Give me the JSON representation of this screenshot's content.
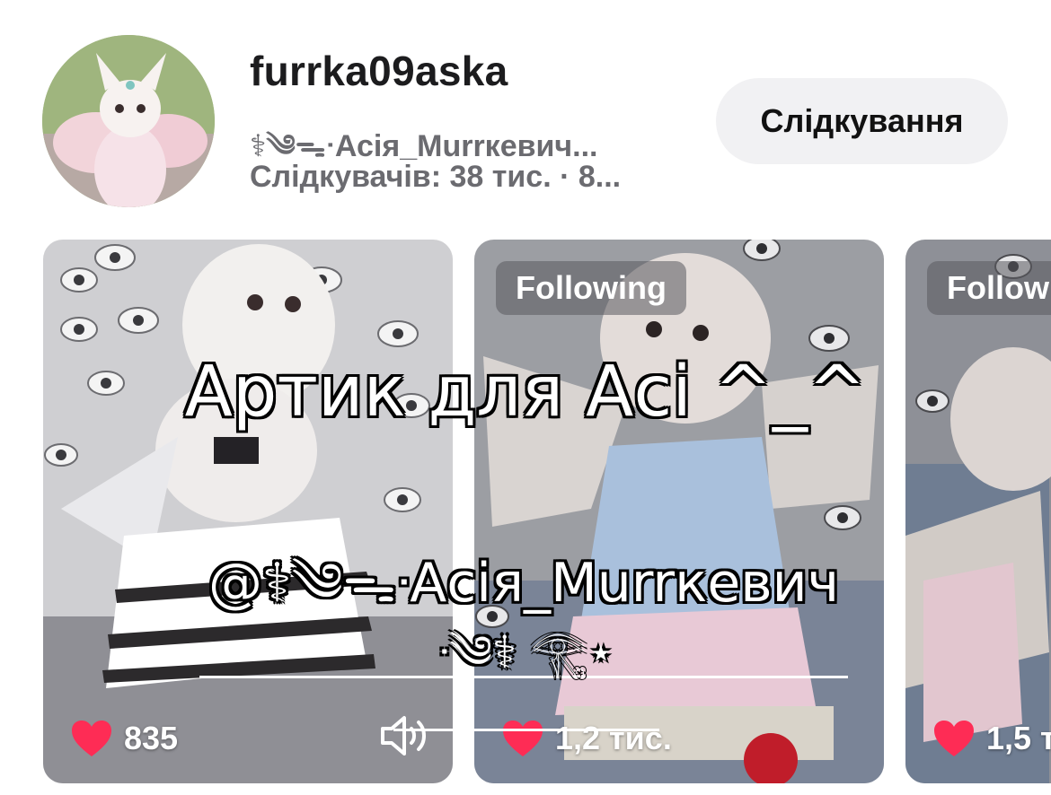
{
  "profile": {
    "username": "furrka09aska",
    "nickname": "⚕︎༄ᯓᐧАсія_Murrкевич...",
    "stats": "Слідкувачів: 38 тис. · 8...",
    "follow_button": "Слідкування",
    "avatar_icon": "profile-avatar"
  },
  "cards": [
    {
      "tag": "",
      "likes": "835",
      "sound_icon": "speaker-icon"
    },
    {
      "tag": "Following",
      "likes": "1,2 тис."
    },
    {
      "tag": "Follow",
      "likes": "1,5 т"
    }
  ],
  "overlay": {
    "title": "Артик для Асі ^_^",
    "handle": "@⚕︎༄ᯓᐧАсія_Murrкевич",
    "decoration": "ᐧ༄⚕︎ 𓂀⋆"
  },
  "colors": {
    "heart": "#fe2c55",
    "follow_button_bg": "#f1f1f3",
    "secondary_text": "#6b6b70"
  }
}
